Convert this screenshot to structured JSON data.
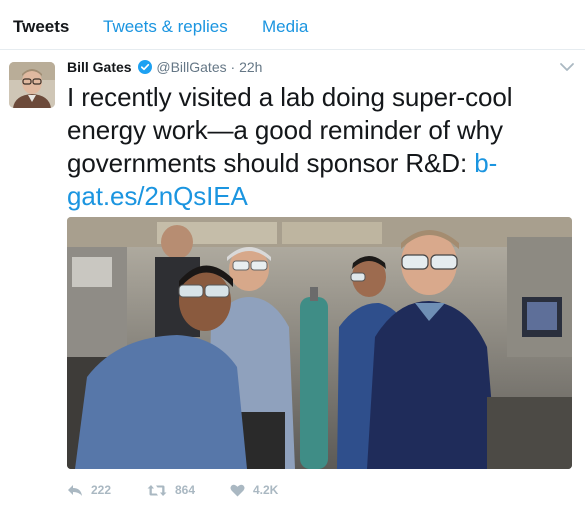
{
  "tabs": [
    {
      "label": "Tweets",
      "active": true
    },
    {
      "label": "Tweets & replies",
      "active": false
    },
    {
      "label": "Media",
      "active": false
    }
  ],
  "tweet": {
    "author_name": "Bill Gates",
    "handle": "@BillGates",
    "separator": "·",
    "time": "22h",
    "text": "I recently visited a lab doing super-cool energy work—a good reminder of why governments should sponsor R&D: ",
    "link": "b-gat.es/2nQsIEA",
    "verified_color": "#1da1f2",
    "link_color": "#1b95e0"
  },
  "actions": {
    "reply": {
      "icon": "reply-icon",
      "count": "222"
    },
    "retweet": {
      "icon": "retweet-icon",
      "count": "864"
    },
    "like": {
      "icon": "heart-icon",
      "count": "4.2K"
    }
  }
}
